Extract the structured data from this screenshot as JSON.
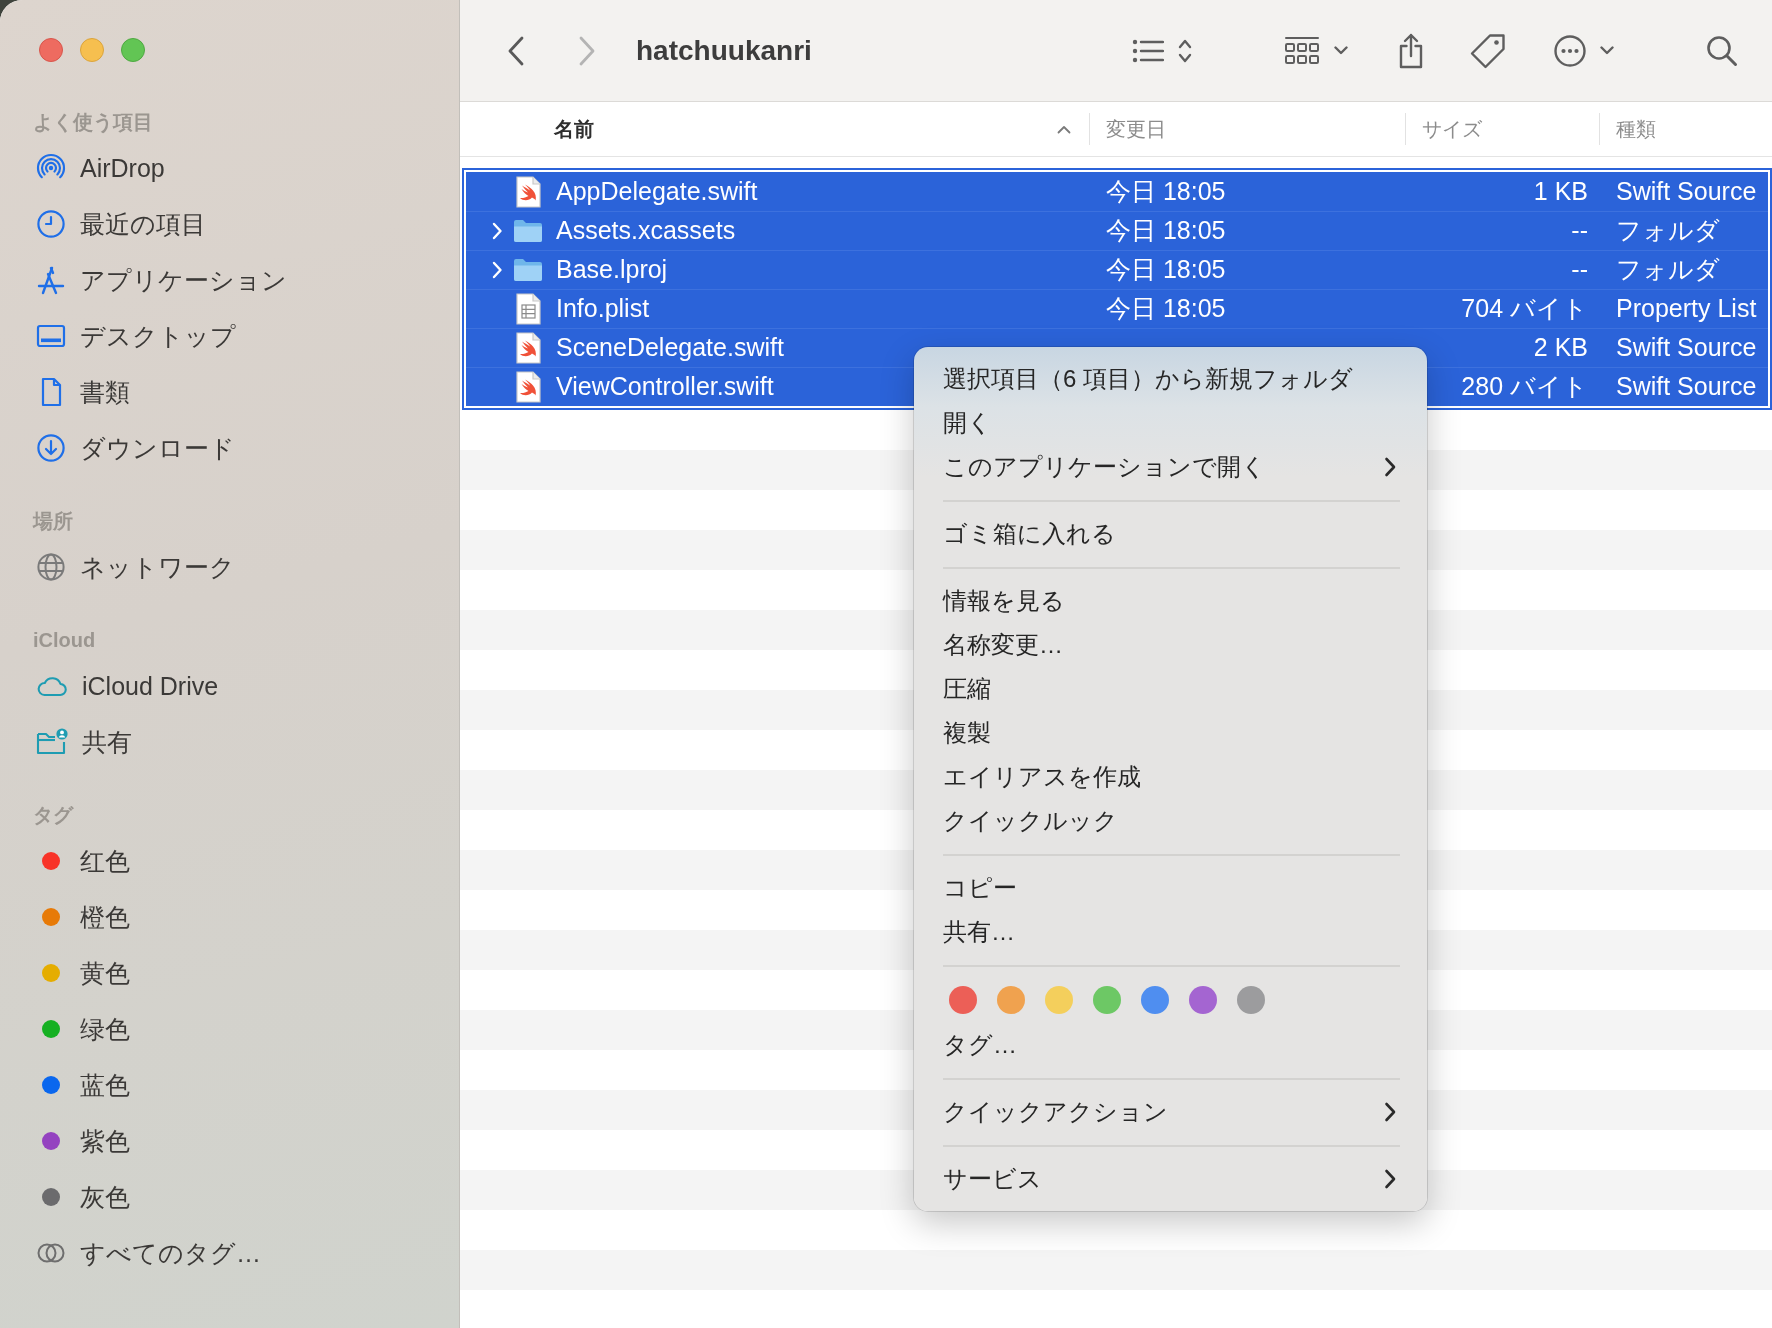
{
  "sidebar": {
    "sections": [
      {
        "title": "よく使う項目",
        "items": [
          "AirDrop",
          "最近の項目",
          "アプリケーション",
          "デスクトップ",
          "書類",
          "ダウンロード"
        ]
      },
      {
        "title": "場所",
        "items": [
          "ネットワーク"
        ]
      },
      {
        "title": "iCloud",
        "items": [
          "iCloud Drive",
          "共有"
        ]
      }
    ],
    "tags": {
      "title": "タグ",
      "items": [
        {
          "label": "红色",
          "color": "#f83328"
        },
        {
          "label": "橙色",
          "color": "#e77a07"
        },
        {
          "label": "黄色",
          "color": "#e5ad00"
        },
        {
          "label": "绿色",
          "color": "#16b022"
        },
        {
          "label": "蓝色",
          "color": "#0a67ee"
        },
        {
          "label": "紫色",
          "color": "#9442c0"
        },
        {
          "label": "灰色",
          "color": "#6b6b6d"
        }
      ],
      "all_tags": "すべてのタグ…"
    }
  },
  "toolbar": {
    "back": {
      "disabled": false
    },
    "forward": {
      "disabled": true
    },
    "title": "hatchuukanri"
  },
  "table": {
    "sort_ascending": true,
    "columns": [
      {
        "label": "名前",
        "sorted": true
      },
      {
        "label": "変更日",
        "sorted": false
      },
      {
        "label": "サイズ",
        "sorted": false
      },
      {
        "label": "種類",
        "sorted": false
      }
    ],
    "rows": [
      {
        "kind": "swift",
        "name": "AppDelegate.swift",
        "selected": true,
        "modified": "今日 18:05",
        "size": "1 KB",
        "kind_label": "Swift Source"
      },
      {
        "kind": "folder",
        "name": "Assets.xcassets",
        "expanded": false,
        "selected": true,
        "modified": "今日 18:05",
        "size": "--",
        "kind_label": "フォルダ"
      },
      {
        "kind": "folder",
        "name": "Base.lproj",
        "expanded": false,
        "selected": true,
        "modified": "今日 18:05",
        "size": "--",
        "kind_label": "フォルダ"
      },
      {
        "kind": "plist",
        "name": "Info.plist",
        "selected": true,
        "modified": "今日 18:05",
        "size": "704 バイト",
        "kind_label": "Property List"
      },
      {
        "kind": "swift",
        "name": "SceneDelegate.swift",
        "selected": true,
        "size": "2 KB",
        "kind_label": "Swift Source"
      },
      {
        "kind": "swift",
        "name": "ViewController.swift",
        "selected": true,
        "size": "280 バイト",
        "kind_label": "Swift Source"
      }
    ]
  },
  "context_menu": {
    "items": [
      {
        "kind": "item",
        "label": "選択項目（6 項目）から新規フォルダ",
        "submenu": false
      },
      {
        "kind": "item",
        "label": "開く",
        "submenu": false
      },
      {
        "kind": "item",
        "label": "このアプリケーションで開く",
        "submenu": true
      },
      {
        "kind": "separator"
      },
      {
        "kind": "item",
        "label": "ゴミ箱に入れる",
        "submenu": false
      },
      {
        "kind": "separator"
      },
      {
        "kind": "item",
        "label": "情報を見る",
        "submenu": false
      },
      {
        "kind": "item",
        "label": "名称変更…",
        "submenu": false
      },
      {
        "kind": "item",
        "label": "圧縮",
        "submenu": false
      },
      {
        "kind": "item",
        "label": "複製",
        "submenu": false
      },
      {
        "kind": "item",
        "label": "エイリアスを作成",
        "submenu": false
      },
      {
        "kind": "item",
        "label": "クイックルック",
        "submenu": false
      },
      {
        "kind": "separator"
      },
      {
        "kind": "item",
        "label": "コピー",
        "submenu": false
      },
      {
        "kind": "item",
        "label": "共有…",
        "submenu": false
      },
      {
        "kind": "separator"
      },
      {
        "kind": "tags",
        "tags": [
          {
            "color": "#ec5f57"
          },
          {
            "color": "#f0a24f"
          },
          {
            "color": "#f4cf5c"
          },
          {
            "color": "#6dc865"
          },
          {
            "color": "#4f8ef0"
          },
          {
            "color": "#a465d1"
          },
          {
            "color": "#9c9c9e"
          }
        ]
      },
      {
        "kind": "item",
        "label": "タグ…",
        "submenu": false
      },
      {
        "kind": "separator"
      },
      {
        "kind": "item",
        "label": "クイックアクション",
        "submenu": true
      },
      {
        "kind": "separator"
      },
      {
        "kind": "item",
        "label": "サービス",
        "submenu": true
      }
    ]
  }
}
